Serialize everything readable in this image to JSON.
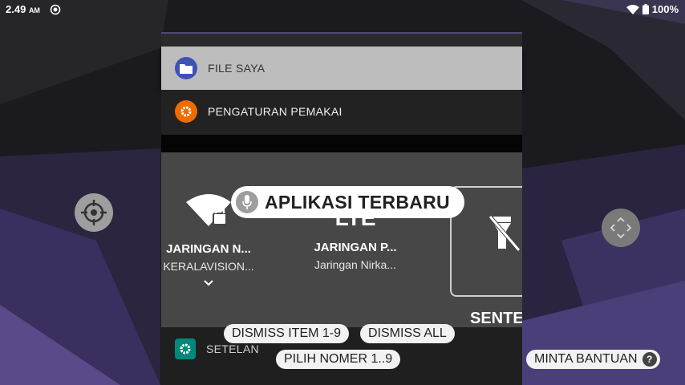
{
  "status_bar": {
    "time": "2.49",
    "ampm": "AM",
    "battery": "100%"
  },
  "recents": {
    "cards": [
      {
        "title": "FILE SAYA",
        "icon": "folder-icon",
        "color": "#3f51b5"
      },
      {
        "title": "PENGATURAN PEMAKAI",
        "icon": "gear-icon",
        "color": "#ef6c00"
      },
      {
        "title": "SETELAN",
        "icon": "gear-icon",
        "color": "#00897b"
      }
    ]
  },
  "quick_settings": {
    "tiles": [
      {
        "label": "JARINGAN N...",
        "sub": "KERALAVISION...",
        "icon": "wifi-locked-icon"
      },
      {
        "label": "JARINGAN P...",
        "sub": "Jaringan Nirka...",
        "icon": "lte-icon",
        "icon_text": "LTE"
      },
      {
        "label": "SENTER",
        "icon": "flashlight-off-icon"
      }
    ]
  },
  "voice_overlay": {
    "title": "APLIKASI TERBARU",
    "commands": {
      "dismiss_item": "DISMISS ITEM 1-9",
      "dismiss_all": "DISMISS ALL",
      "pick_number": "PILIH NOMER 1..9",
      "help": "MINTA BANTUAN",
      "help_icon": "?"
    }
  }
}
